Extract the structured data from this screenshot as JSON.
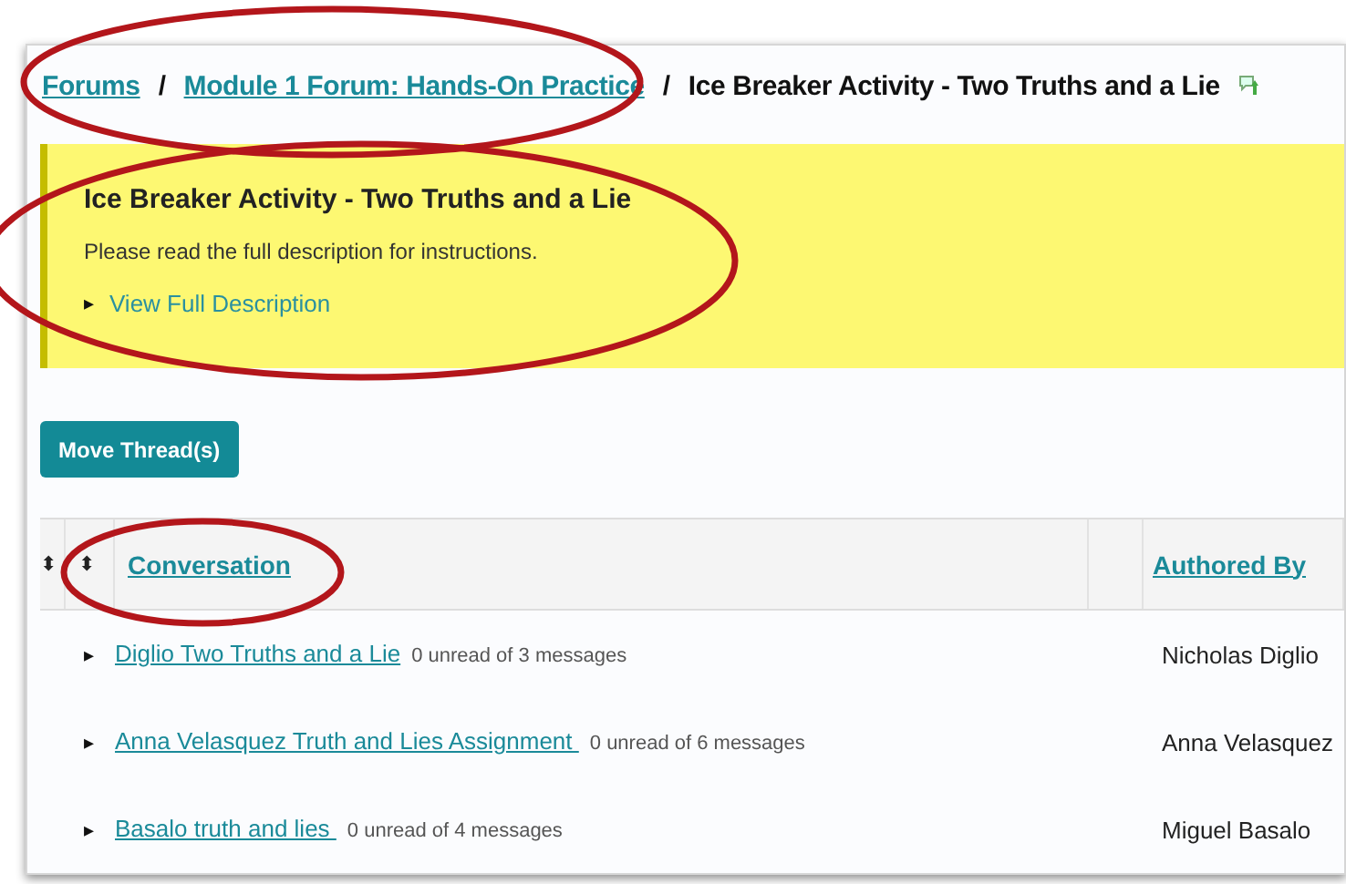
{
  "breadcrumb": {
    "links": [
      "Forums",
      "Module 1 Forum: Hands-On Practice"
    ],
    "separator": "/",
    "current": "Ice Breaker Activity - Two Truths and a Lie"
  },
  "notice": {
    "title": "Ice Breaker Activity - Two Truths and a Lie",
    "text": "Please read the full description for instructions.",
    "toggle": "▸",
    "link": "View Full Description"
  },
  "move_button": "Move Thread(s)",
  "table": {
    "sort_icon": "⬍",
    "columns": [
      "Conversation",
      "Authored By"
    ],
    "rows": [
      {
        "toggle": "▸",
        "title": "Diglio Two Truths and a Lie",
        "count": "0 unread of 3 messages",
        "author": "Nicholas Diglio"
      },
      {
        "toggle": "▸",
        "title": "Anna Velasquez Truth and Lies Assignment ",
        "count": "0 unread of 6 messages",
        "author": "Anna Velasquez"
      },
      {
        "toggle": "▸",
        "title": "Basalo truth and lies ",
        "count": "0 unread of 4 messages",
        "author": "Miguel Basalo"
      }
    ]
  },
  "annotations": [
    {
      "kind": "ellipse"
    },
    {
      "kind": "ellipse"
    },
    {
      "kind": "ellipse"
    }
  ]
}
